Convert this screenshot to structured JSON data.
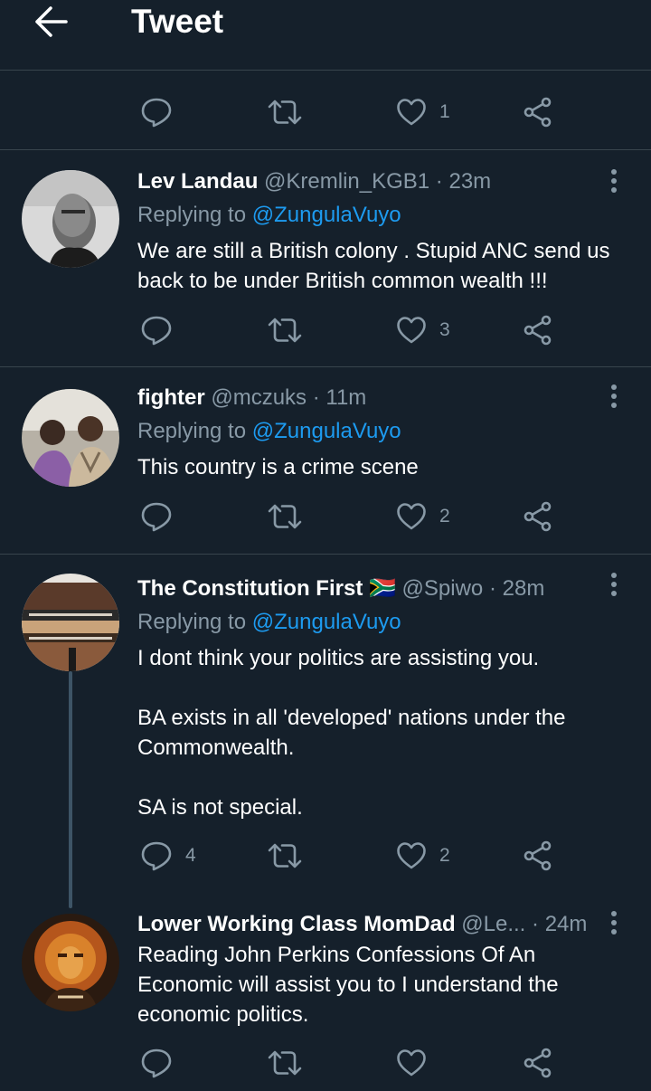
{
  "header": {
    "title": "Tweet",
    "back_icon": "arrow-left-icon"
  },
  "colors": {
    "background": "#15202b",
    "divider": "#38444d",
    "muted": "#8899a6",
    "accent": "#1d9bf0"
  },
  "main_actions": {
    "likes": "1"
  },
  "replies": [
    {
      "name": "Lev Landau",
      "handle": "@Kremlin_KGB1",
      "time": "23m",
      "replying_prefix": "Replying to ",
      "replying_to": "@ZungulaVuyo",
      "text": [
        "We are still a British colony . Stupid ANC send us",
        "back to be under British common wealth !!!"
      ],
      "comments": "",
      "retweets": "",
      "likes": "3"
    },
    {
      "name": "fighter",
      "handle": "@mczuks",
      "time": "11m",
      "replying_prefix": "Replying to ",
      "replying_to": "@ZungulaVuyo",
      "text": [
        "This country is a crime scene"
      ],
      "comments": "",
      "retweets": "",
      "likes": "2"
    },
    {
      "name": "The Constitution First",
      "flag": "🇿🇦",
      "handle": "@Spiwo",
      "time": "28m",
      "replying_prefix": "Replying to ",
      "replying_to": "@ZungulaVuyo",
      "text": [
        "I dont think your politics are assisting you.",
        "",
        "BA exists in all 'developed' nations under the",
        "Commonwealth.",
        "",
        "SA is not special."
      ],
      "comments": "4",
      "retweets": "",
      "likes": "2"
    },
    {
      "name": "Lower Working Class MomDad",
      "handle": "@Le...",
      "time": "24m",
      "text": [
        "Reading John Perkins Confessions Of An",
        "Economic will assist you to I understand the",
        "economic politics."
      ],
      "comments": "",
      "retweets": "",
      "likes": ""
    }
  ],
  "icons": {
    "reply": "reply-icon",
    "retweet": "retweet-icon",
    "like": "heart-icon",
    "share": "share-icon",
    "more": "more-vertical-icon"
  }
}
